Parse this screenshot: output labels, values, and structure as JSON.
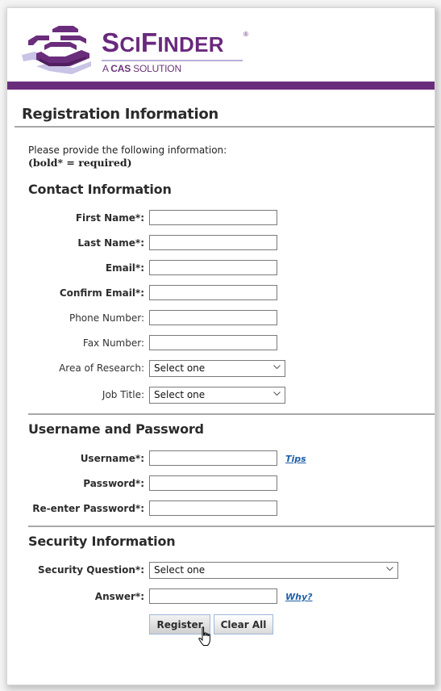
{
  "brand": {
    "name_prefix": "S",
    "name_small": "CI",
    "name_main": "F",
    "name_rest": "INDER",
    "registered_mark": "®",
    "tagline_prefix": "A ",
    "tagline_bold": "CAS",
    "tagline_suffix": " SOLUTION",
    "color": "#6a2d7c"
  },
  "page": {
    "title": "Registration Information",
    "intro_line1": "Please provide the following information:",
    "intro_line2": "(bold* = required)"
  },
  "sections": {
    "contact": {
      "title": "Contact Information",
      "fields": {
        "first_name": {
          "label": "First Name*:",
          "value": ""
        },
        "last_name": {
          "label": "Last Name*:",
          "value": ""
        },
        "email": {
          "label": "Email*:",
          "value": ""
        },
        "confirm_email": {
          "label": "Confirm Email*:",
          "value": ""
        },
        "phone": {
          "label": "Phone Number:",
          "value": ""
        },
        "fax": {
          "label": "Fax Number:",
          "value": ""
        },
        "area_of_research": {
          "label": "Area of Research:",
          "selected": "Select one"
        },
        "job_title": {
          "label": "Job Title:",
          "selected": "Select one"
        }
      }
    },
    "account": {
      "title": "Username and Password",
      "fields": {
        "username": {
          "label": "Username*:",
          "value": ""
        },
        "password": {
          "label": "Password*:",
          "value": ""
        },
        "reenter_password": {
          "label": "Re-enter Password*:",
          "value": ""
        }
      },
      "tips_link": "Tips"
    },
    "security": {
      "title": "Security Information",
      "fields": {
        "question": {
          "label": "Security Question*:",
          "selected": "Select one"
        },
        "answer": {
          "label": "Answer*:",
          "value": ""
        }
      },
      "why_link": "Why?"
    }
  },
  "actions": {
    "register": "Register",
    "clear_all": "Clear All"
  },
  "icons": {
    "logo": "scifinder-logo-icon",
    "dropdown": "chevron-down-icon",
    "cursor": "hand-pointer-icon"
  },
  "colors": {
    "brand_purple": "#6a2d7c",
    "link_blue": "#1f5fa8",
    "button_border": "#9fb7d6"
  }
}
